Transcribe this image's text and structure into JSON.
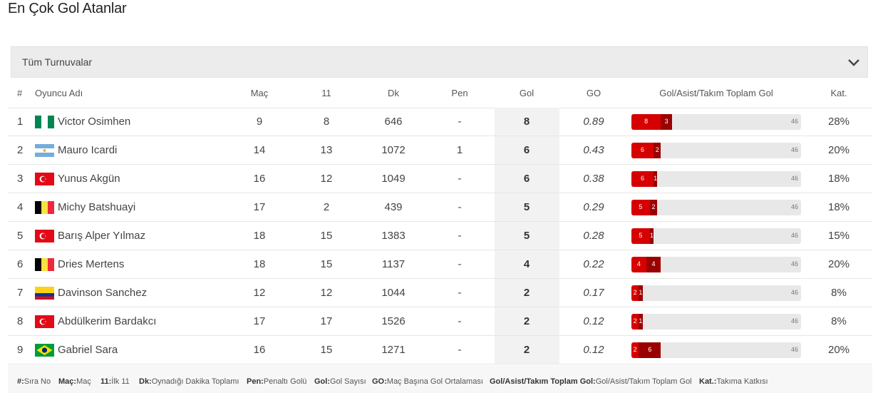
{
  "page_title": "En Çok Gol Atanlar",
  "dropdown": {
    "label": "Tüm Turnuvalar",
    "icon": "chevron-down-icon"
  },
  "table": {
    "headers": {
      "rank": "#",
      "player": "Oyuncu Adı",
      "mac": "Maç",
      "ilk11": "11",
      "dk": "Dk",
      "pen": "Pen",
      "gol": "Gol",
      "go": "GO",
      "bar": "Gol/Asist/Takım Toplam Gol",
      "kat": "Kat."
    },
    "rows": [
      {
        "rank": "1",
        "flag": "nigeria-flag",
        "name": "Victor Osimhen",
        "mac": "9",
        "ilk11": "8",
        "dk": "646",
        "pen": "-",
        "gol": "8",
        "go": "0.89",
        "goals": 8,
        "assists": 3,
        "team_total": "46",
        "kat": "28%"
      },
      {
        "rank": "2",
        "flag": "argentina-flag",
        "name": "Mauro Icardi",
        "mac": "14",
        "ilk11": "13",
        "dk": "1072",
        "pen": "1",
        "gol": "6",
        "go": "0.43",
        "goals": 6,
        "assists": 2,
        "team_total": "46",
        "kat": "20%"
      },
      {
        "rank": "3",
        "flag": "turkey-flag",
        "name": "Yunus Akgün",
        "mac": "16",
        "ilk11": "12",
        "dk": "1049",
        "pen": "-",
        "gol": "6",
        "go": "0.38",
        "goals": 6,
        "assists": 1,
        "team_total": "46",
        "kat": "18%"
      },
      {
        "rank": "4",
        "flag": "belgium-flag",
        "name": "Michy Batshuayi",
        "mac": "17",
        "ilk11": "2",
        "dk": "439",
        "pen": "-",
        "gol": "5",
        "go": "0.29",
        "goals": 5,
        "assists": 2,
        "team_total": "46",
        "kat": "18%"
      },
      {
        "rank": "5",
        "flag": "turkey-flag",
        "name": "Barış Alper Yılmaz",
        "mac": "18",
        "ilk11": "15",
        "dk": "1383",
        "pen": "-",
        "gol": "5",
        "go": "0.28",
        "goals": 5,
        "assists": 1,
        "team_total": "46",
        "kat": "15%"
      },
      {
        "rank": "6",
        "flag": "belgium-flag",
        "name": "Dries Mertens",
        "mac": "18",
        "ilk11": "15",
        "dk": "1137",
        "pen": "-",
        "gol": "4",
        "go": "0.22",
        "goals": 4,
        "assists": 4,
        "team_total": "46",
        "kat": "20%"
      },
      {
        "rank": "7",
        "flag": "colombia-flag",
        "name": "Davinson Sanchez",
        "mac": "12",
        "ilk11": "12",
        "dk": "1044",
        "pen": "-",
        "gol": "2",
        "go": "0.17",
        "goals": 2,
        "assists": 1,
        "team_total": "46",
        "kat": "8%"
      },
      {
        "rank": "8",
        "flag": "turkey-flag",
        "name": "Abdülkerim Bardakcı",
        "mac": "17",
        "ilk11": "17",
        "dk": "1526",
        "pen": "-",
        "gol": "2",
        "go": "0.12",
        "goals": 2,
        "assists": 1,
        "team_total": "46",
        "kat": "8%"
      },
      {
        "rank": "9",
        "flag": "brazil-flag",
        "name": "Gabriel Sara",
        "mac": "16",
        "ilk11": "15",
        "dk": "1271",
        "pen": "-",
        "gol": "2",
        "go": "0.12",
        "goals": 2,
        "assists": 6,
        "team_total": "46",
        "kat": "20%"
      }
    ]
  },
  "legend": [
    {
      "key": "#:",
      "value": "Sıra No"
    },
    {
      "key": "Maç:",
      "value": "Maç"
    },
    {
      "key": "11:",
      "value": "İlk 11"
    },
    {
      "key": "Dk:",
      "value": "Oynadığı Dakika Toplamı"
    },
    {
      "key": "Pen:",
      "value": "Penaltı Golü"
    },
    {
      "key": "Gol:",
      "value": "Gol Sayısı"
    },
    {
      "key": "GO:",
      "value": "Maç Başına Gol Ortalaması"
    },
    {
      "key": "Gol/Asist/Takım Toplam Gol:",
      "value": "Gol/Asist/Takım Toplam Gol"
    },
    {
      "key": "Kat.:",
      "value": "Takıma Katkısı"
    }
  ],
  "colors": {
    "goal_bar": "#d60000",
    "assist_bar": "#9b0000",
    "bar_track": "#e8e8e8"
  }
}
